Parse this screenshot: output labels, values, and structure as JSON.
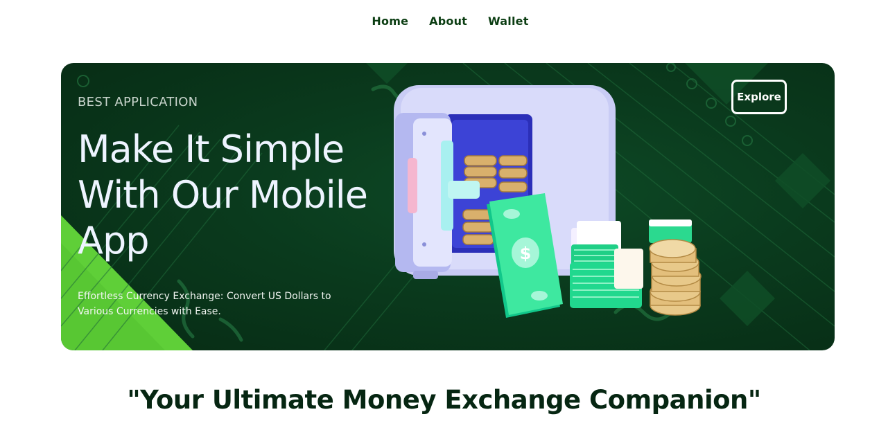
{
  "nav": {
    "items": [
      {
        "label": "Home"
      },
      {
        "label": "About"
      },
      {
        "label": "Wallet"
      }
    ]
  },
  "hero": {
    "eyebrow": "BEST APPLICATION",
    "headline": "Make It Simple With Our Mobile App",
    "subtext": "Effortless Currency Exchange: Convert US Dollars to Various Currencies with Ease.",
    "explore_label": "Explore",
    "colors": {
      "background": "#0a3a1d",
      "accent_green": "#5fd13a",
      "cash_green": "#3ee8a0",
      "gold": "#e8c98a",
      "safe_lavender": "#c9ccf5"
    }
  },
  "tagline": "\"Your Ultimate Money Exchange Companion\""
}
